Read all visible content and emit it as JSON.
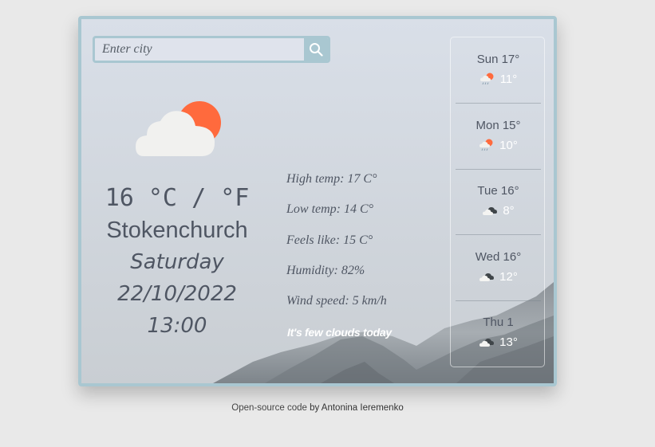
{
  "search": {
    "placeholder": "Enter city",
    "value": ""
  },
  "current": {
    "icon": "few-clouds-day-icon",
    "temperature": "16",
    "unit_c": "°C",
    "separator": "/",
    "unit_f": "°F",
    "city": "Stokenchurch",
    "day": "Saturday",
    "date": "22/10/2022",
    "time": "13:00"
  },
  "details": {
    "high": "High temp: 17 C°",
    "low": "Low temp: 14 C°",
    "feels": "Feels like: 15 C°",
    "humidity": "Humidity: 82%",
    "wind": "Wind speed: 5 km/h",
    "description": "It's few clouds today"
  },
  "forecast": [
    {
      "day": "Sun 17°",
      "temp": "11°",
      "icon": "rain-sun-icon"
    },
    {
      "day": "Mon 15°",
      "temp": "10°",
      "icon": "rain-sun-icon"
    },
    {
      "day": "Tue 16°",
      "temp": "8°",
      "icon": "broken-clouds-icon"
    },
    {
      "day": "Wed 16°",
      "temp": "12°",
      "icon": "broken-clouds-icon"
    },
    {
      "day": "Thu 1",
      "temp": "13°",
      "icon": "broken-clouds-icon"
    }
  ],
  "footer": {
    "link_text": "Open-source code",
    "author_text": " by Antonina Ieremenko"
  },
  "colors": {
    "accent": "#a9c7d1",
    "sun": "#ff6a3d",
    "text": "#4f5663",
    "background": "#e9e9e9"
  }
}
